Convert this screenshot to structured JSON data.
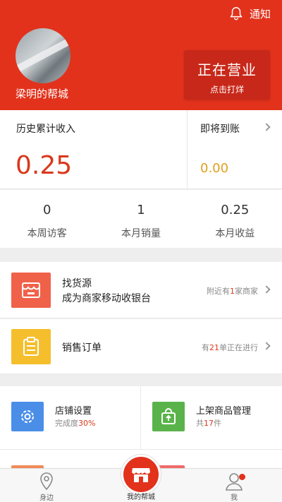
{
  "header": {
    "notice_label": "通知",
    "store_name": "梁明的帮城",
    "status_title": "正在营业",
    "status_action": "点击打烊"
  },
  "income": {
    "history_label": "历史累计收入",
    "history_value": "0.25",
    "pending_label": "即将到账",
    "pending_value": "0.00"
  },
  "stats": [
    {
      "value": "0",
      "label": "本周访客"
    },
    {
      "value": "1",
      "label": "本月销量"
    },
    {
      "value": "0.25",
      "label": "本月收益"
    }
  ],
  "rows": {
    "supply": {
      "line1": "找货源",
      "line2": "成为商家移动收银台",
      "side_prefix": "附近有",
      "side_count": "1",
      "side_suffix": "家商家"
    },
    "orders": {
      "line1": "销售订单",
      "side_prefix": "有",
      "side_count": "21",
      "side_suffix": "单正在进行"
    }
  },
  "grid": {
    "shop_settings": {
      "title": "店铺设置",
      "sub_prefix": "完成度",
      "sub_value": "30%"
    },
    "product_mgmt": {
      "title": "上架商品管理",
      "sub_prefix": "共",
      "sub_value": "17",
      "sub_suffix": "件"
    }
  },
  "tabbar": {
    "nearby": "身边",
    "mine_shop": "我的帮城",
    "me": "我"
  },
  "colors": {
    "brand_red": "#e2321c",
    "supply_icon_bg": "#f0614a",
    "orders_icon_bg": "#f5be2c",
    "settings_icon_bg": "#4a8ee8",
    "products_icon_bg": "#5ab34a",
    "pending_value": "#e0a020"
  }
}
